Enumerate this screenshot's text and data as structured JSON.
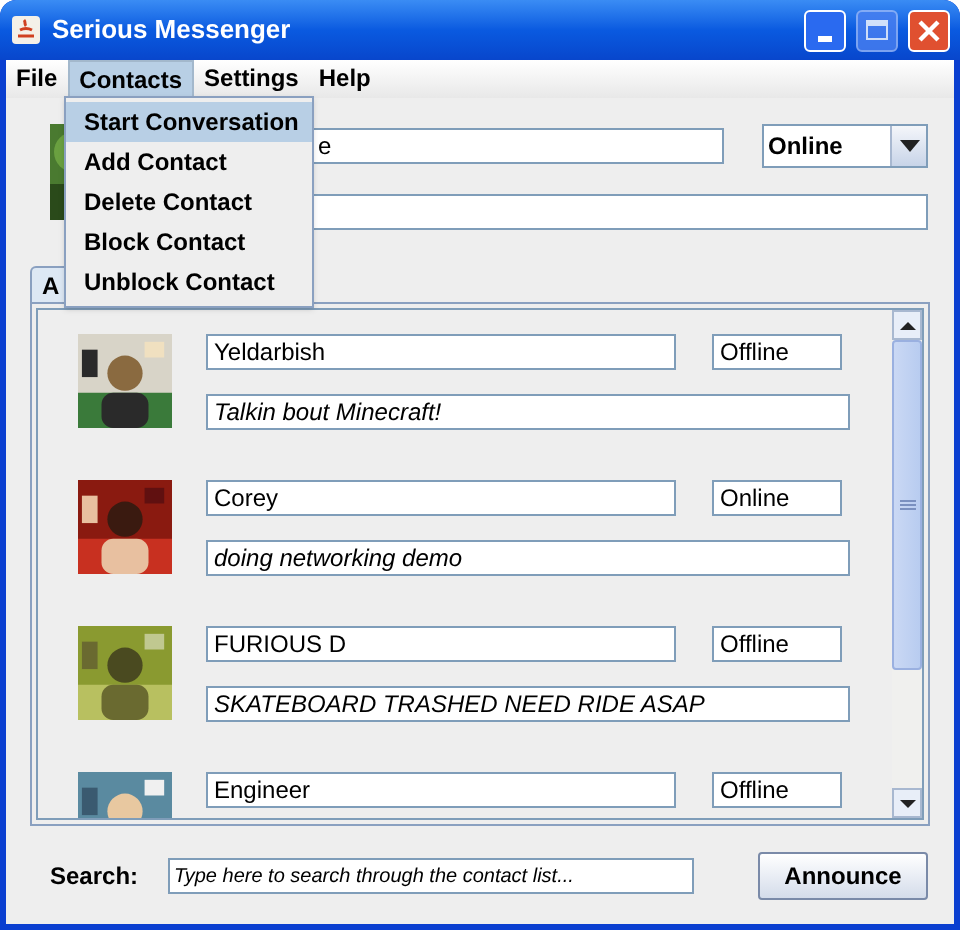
{
  "window": {
    "title": "Serious Messenger"
  },
  "menu": [
    {
      "label": "File",
      "selected": false
    },
    {
      "label": "Contacts",
      "selected": true
    },
    {
      "label": "Settings",
      "selected": false
    },
    {
      "label": "Help",
      "selected": false
    }
  ],
  "dropdown": [
    {
      "label": "Start Conversation",
      "selected": true
    },
    {
      "label": "Add Contact",
      "selected": false
    },
    {
      "label": "Delete Contact",
      "selected": false
    },
    {
      "label": "Block Contact",
      "selected": false
    },
    {
      "label": "Unblock Contact",
      "selected": false
    }
  ],
  "profile": {
    "name": "e",
    "status": "Online"
  },
  "tab": {
    "label": "A"
  },
  "contacts": [
    {
      "name": "Yeldarbish",
      "status": "Offline",
      "message": "Talkin bout Minecraft!"
    },
    {
      "name": "Corey",
      "status": "Online",
      "message": "doing networking demo"
    },
    {
      "name": "FURIOUS D",
      "status": "Offline",
      "message": "SKATEBOARD TRASHED NEED RIDE ASAP"
    },
    {
      "name": "Engineer",
      "status": "Offline"
    }
  ],
  "search": {
    "label": "Search:",
    "placeholder": "Type here to search through the contact list..."
  },
  "button": "Announce"
}
